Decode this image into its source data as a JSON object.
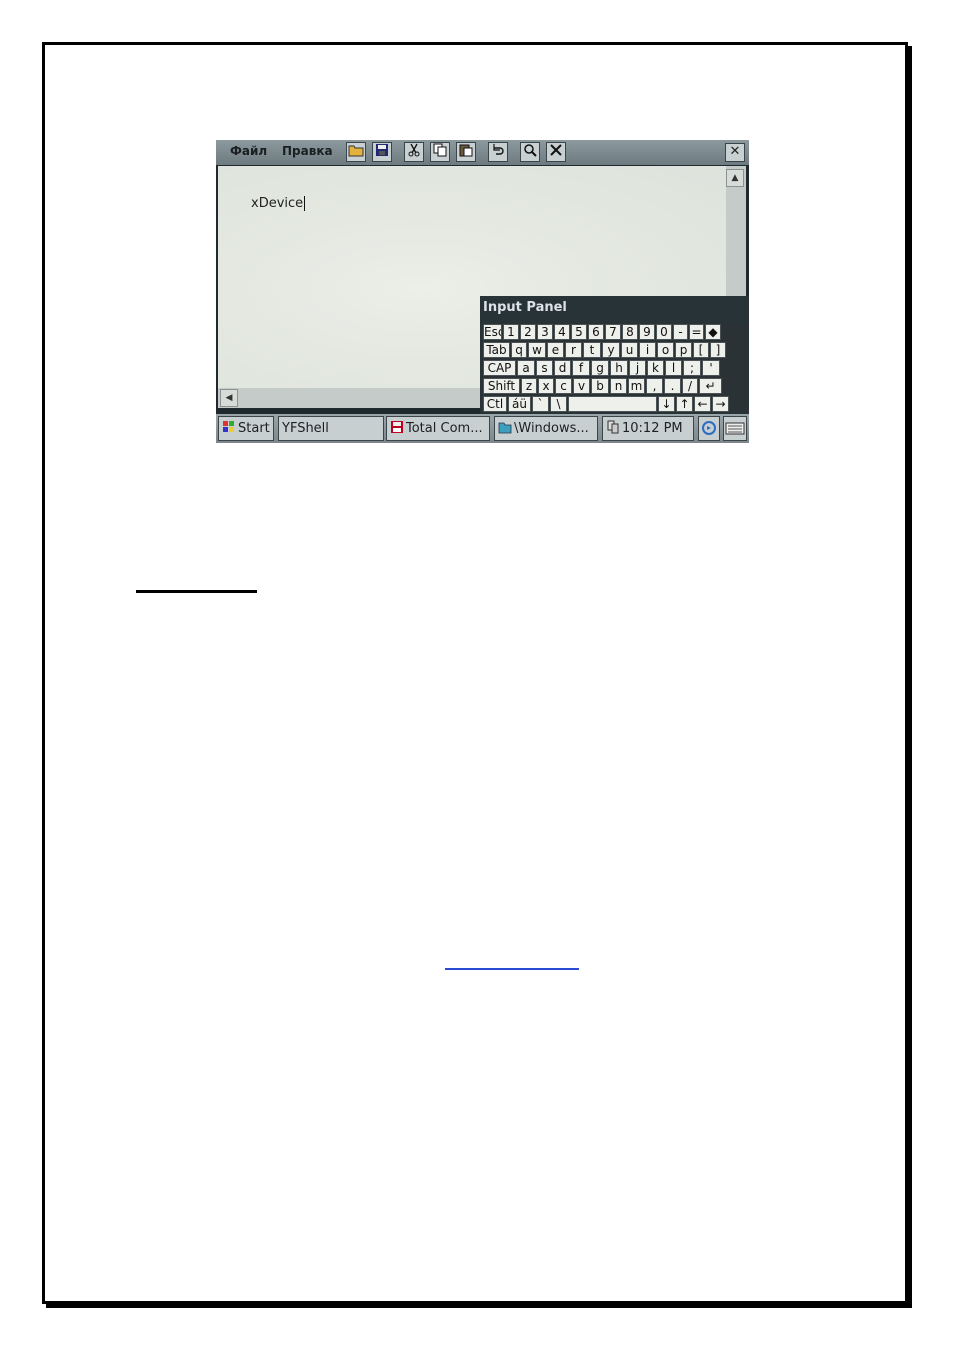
{
  "menubar": {
    "file_menu": "Файл",
    "edit_menu": "Правка",
    "close_glyph": "✕"
  },
  "toolbar_icons": [
    "open-folder-icon",
    "save-icon",
    "cut-icon",
    "copy-icon",
    "paste-icon",
    "undo-icon",
    "find-icon",
    "delete-icon"
  ],
  "document": {
    "text": "xDevice"
  },
  "scroll": {
    "up_glyph": "▲",
    "left_glyph": "◀"
  },
  "input_panel": {
    "title": "Input Panel",
    "rows": [
      [
        "Esc",
        "1",
        "2",
        "3",
        "4",
        "5",
        "6",
        "7",
        "8",
        "9",
        "0",
        "-",
        "=",
        "◆"
      ],
      [
        "Tab",
        "q",
        "w",
        "e",
        "r",
        "t",
        "y",
        "u",
        "i",
        "o",
        "p",
        "[",
        "]"
      ],
      [
        "CAP",
        "a",
        "s",
        "d",
        "f",
        "g",
        "h",
        "j",
        "k",
        "l",
        ";",
        "'"
      ],
      [
        "Shift",
        "z",
        "x",
        "c",
        "v",
        "b",
        "n",
        "m",
        ",",
        ".",
        "/",
        "↵"
      ],
      [
        "Ctl",
        "áü",
        "`",
        "\\",
        "",
        "↓",
        "↑",
        "←",
        "→"
      ]
    ]
  },
  "taskbar": {
    "start": "Start",
    "yfshell": "YFShell",
    "total_commander": "Total Com...",
    "windows": "\\Windows...",
    "clock": "10:12 PM"
  },
  "colors": {
    "accent": "#2b4bd4",
    "screen_bg": "#e4e8e1"
  }
}
